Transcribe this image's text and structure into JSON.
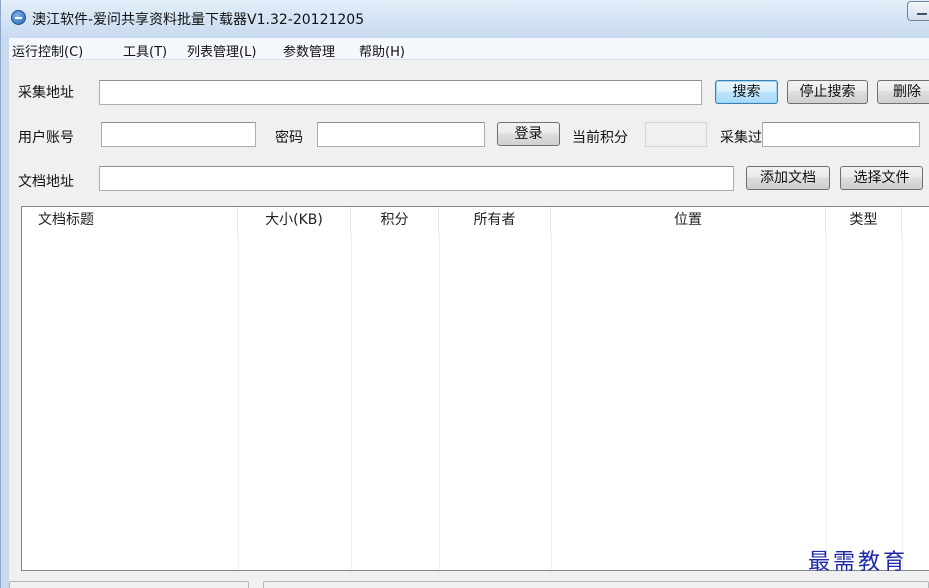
{
  "window": {
    "title": "澳江软件-爱问共享资料批量下载器V1.32-20121205"
  },
  "menu": [
    "运行控制(C)",
    "工具(T)",
    "列表管理(L)",
    "参数管理",
    "帮助(H)"
  ],
  "row1": {
    "label": "采集地址",
    "value": "",
    "search": "搜索",
    "stop": "停止搜索",
    "delete": "删除"
  },
  "row2": {
    "account_label": "用户账号",
    "account_value": "",
    "password_label": "密码",
    "password_value": "",
    "login": "登录",
    "points_label": "当前积分",
    "points_value": "",
    "filter_label": "采集过滤",
    "filter_value": ""
  },
  "row3": {
    "label": "文档地址",
    "value": "",
    "add": "添加文档",
    "choose": "选择文件"
  },
  "table": {
    "columns": [
      "文档标题",
      "大小(KB)",
      "积分",
      "所有者",
      "位置",
      "类型"
    ],
    "rows": []
  },
  "watermark": "最需教育"
}
